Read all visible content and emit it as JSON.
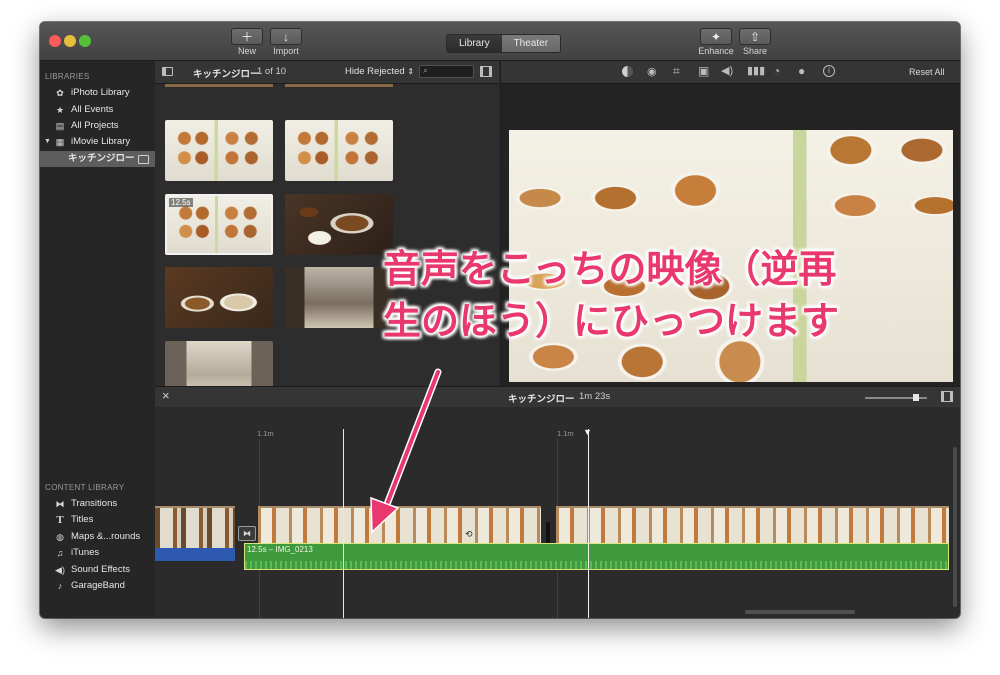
{
  "toolbar": {
    "new_label": "New",
    "import_label": "Import",
    "library_tab": "Library",
    "theater_tab": "Theater",
    "enhance_label": "Enhance",
    "share_label": "Share"
  },
  "sidebar": {
    "libraries_heading": "LIBRARIES",
    "libraries": [
      {
        "label": "iPhoto Library",
        "icon": "iphoto-icon"
      },
      {
        "label": "All Events",
        "icon": "star-icon"
      },
      {
        "label": "All Projects",
        "icon": "film-icon"
      },
      {
        "label": "iMovie Library",
        "icon": "grid-icon"
      },
      {
        "label": "キッチンジロー",
        "icon": "event-icon"
      }
    ],
    "content_heading": "CONTENT LIBRARY",
    "content": [
      {
        "label": "Transitions",
        "icon": "transitions-icon"
      },
      {
        "label": "Titles",
        "icon": "titles-icon"
      },
      {
        "label": "Maps &...rounds",
        "icon": "globe-icon"
      },
      {
        "label": "iTunes",
        "icon": "music-note-icon"
      },
      {
        "label": "Sound Effects",
        "icon": "speaker-icon"
      },
      {
        "label": "GarageBand",
        "icon": "guitar-icon"
      }
    ]
  },
  "browser": {
    "event_name": "キッチンジロー",
    "count": "1 of 10",
    "filter": "Hide Rejected",
    "selected_duration": "12.5s"
  },
  "viewer": {
    "reset_label": "Reset All"
  },
  "timeline": {
    "project_name": "キッチンジロー",
    "duration": "1m 23s",
    "marker_1": "1.1m",
    "marker_2": "1.1m",
    "audio_clip_label": "12.5s – IMG_0213"
  },
  "annotation": {
    "line1": "音声をこっちの映像（逆再",
    "line2": "生のほう）にひっつけます",
    "color": "#e8386d"
  }
}
